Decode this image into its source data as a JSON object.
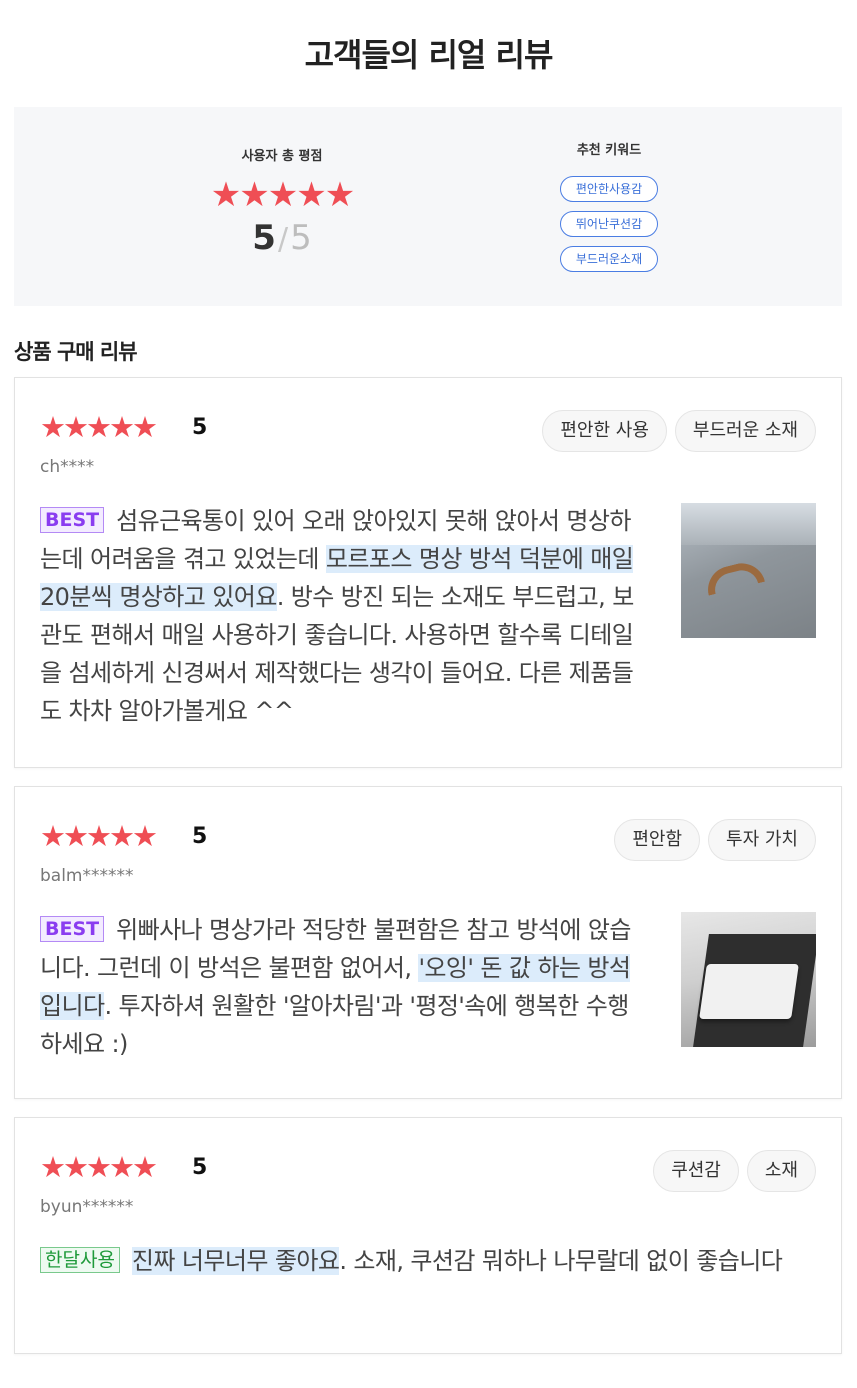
{
  "page_title": "고객들의 리얼 리뷰",
  "summary": {
    "score_label": "사용자 총 평점",
    "stars": "★★★★★",
    "score": "5",
    "slash": "/",
    "max_score": "5",
    "keywords_title": "추천 키워드",
    "keywords": [
      "편안한사용감",
      "뛰어난쿠션감",
      "부드러운소재"
    ]
  },
  "section_title": "상품 구매 리뷰",
  "colors": {
    "star": "#ef4e55",
    "best_badge": "#8a3df0",
    "month_badge": "#1f9a3a",
    "highlight": "#dcecfb",
    "keyword": "#3a6fd8"
  },
  "reviews": [
    {
      "stars": "★★★★★",
      "rating": "5",
      "author": "ch****",
      "tags": [
        "편안한 사용",
        "부드러운 소재"
      ],
      "badge": "BEST",
      "text_before": "섬유근육통이 있어 오래 앉아있지 못해 앉아서 명상하는데 어려움을 겪고 있었는데 ",
      "text_highlight": "모르포스 명상 방석 덕분에 매일 20분씩 명상하고 있어요",
      "text_after": ". 방수 방진 되는 소재도 부드럽고, 보관도 편해서 매일 사용하기 좋습니다. 사용하면 할수록 디테일을 섬세하게 신경써서 제작했다는 생각이 들어요. 다른 제품들도 차차 알아가볼게요 ^^",
      "photo_icon": "cushion-handle-photo"
    },
    {
      "stars": "★★★★★",
      "rating": "5",
      "author": "balm******",
      "tags": [
        "편안함",
        "투자 가치"
      ],
      "badge": "BEST",
      "text_before": "위빠사나 명상가라 적당한 불편함은 참고 방석에 앉습니다. 그런데 이 방석은 불편함 없어서, ",
      "text_highlight": "'오잉' 돈 값 하는 방석입니다",
      "text_after": ". 투자하셔 원활한 '알아차림'과 '평정'속에 행복한 수행하세요 :)",
      "photo_icon": "cushion-on-mat-photo"
    },
    {
      "stars": "★★★★★",
      "rating": "5",
      "author": "byun******",
      "tags": [
        "쿠션감",
        "소재"
      ],
      "badge": "한달사용",
      "text_before": "",
      "text_highlight": "진짜 너무너무 좋아요",
      "text_after": ". 소재, 쿠션감 뭐하나 나무랄데 없이 좋습니다"
    }
  ]
}
